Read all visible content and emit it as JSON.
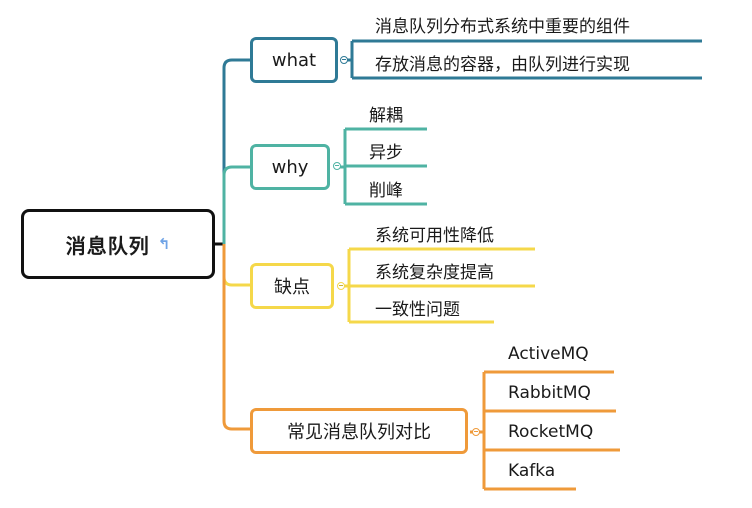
{
  "root": {
    "label": "消息队列",
    "icon": "return-arrow-icon"
  },
  "colors": {
    "root": "#111111",
    "what": "#2f7a96",
    "why": "#4fb3a3",
    "cons": "#f5d84a",
    "compare": "#ef9a3a",
    "marker": "#6fa3e6"
  },
  "topics": [
    {
      "id": "what",
      "label": "what",
      "children": [
        "消息队列分布式系统中重要的组件",
        "存放消息的容器，由队列进行实现"
      ]
    },
    {
      "id": "why",
      "label": "why",
      "children": [
        "解耦",
        "异步",
        "削峰"
      ]
    },
    {
      "id": "cons",
      "label": "缺点",
      "children": [
        "系统可用性降低",
        "系统复杂度提高",
        "一致性问题"
      ]
    },
    {
      "id": "compare",
      "label": "常见消息队列对比",
      "children": [
        "ActiveMQ",
        "RabbitMQ",
        "RocketMQ",
        "Kafka"
      ]
    }
  ]
}
